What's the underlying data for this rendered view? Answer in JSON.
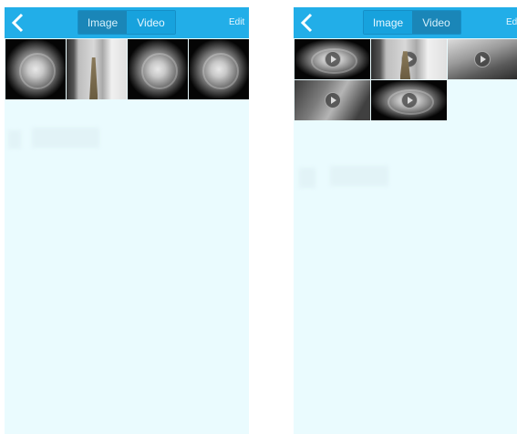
{
  "left_screen": {
    "nav": {
      "image_label": "Image",
      "video_label": "Video",
      "edit_label": "Edit",
      "selected": "video"
    },
    "items": [
      {
        "kind": "photo",
        "scene": "fisheye"
      },
      {
        "kind": "photo",
        "scene": "corridor"
      },
      {
        "kind": "photo",
        "scene": "fisheye"
      },
      {
        "kind": "photo",
        "scene": "fisheye"
      }
    ]
  },
  "right_screen": {
    "nav": {
      "image_label": "Image",
      "video_label": "Video",
      "edit_label": "Ed",
      "selected": "image"
    },
    "items": [
      {
        "kind": "video",
        "scene": "fisheye"
      },
      {
        "kind": "video",
        "scene": "corridor"
      },
      {
        "kind": "video",
        "scene": "room"
      },
      {
        "kind": "video",
        "scene": "dark-room"
      },
      {
        "kind": "video",
        "scene": "fisheye"
      }
    ]
  },
  "colors": {
    "topbar": "#22aee8",
    "content_bg": "#eafbfe",
    "segment_selected": "#17a2dd",
    "segment_unselected": "#1a86b8"
  },
  "icons": [
    "back-arrow-icon",
    "play-icon"
  ]
}
